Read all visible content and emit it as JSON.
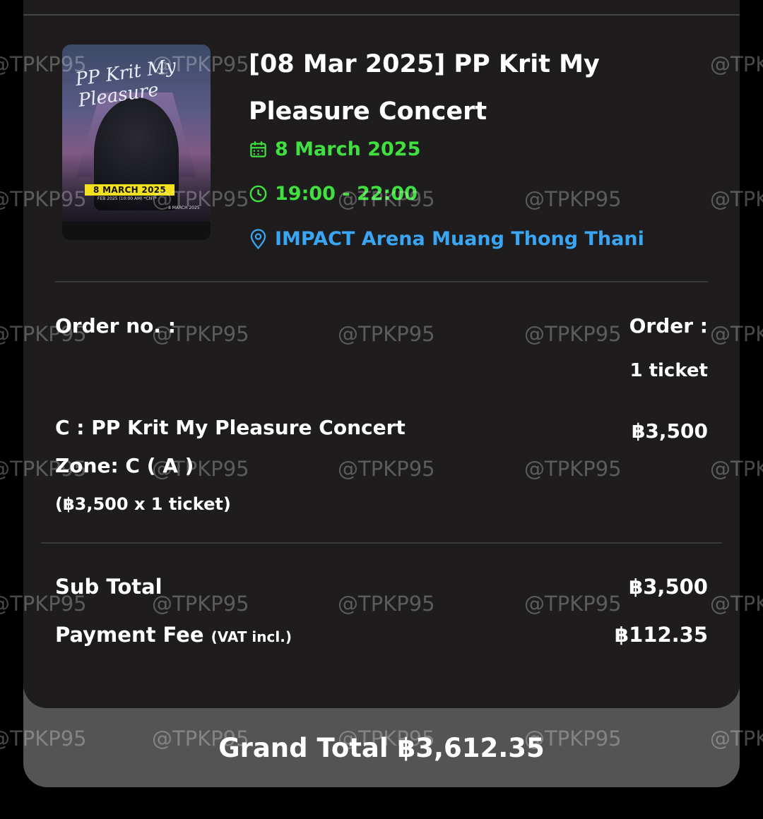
{
  "event": {
    "title": "[08 Mar 2025] PP Krit My Pleasure Concert",
    "date": "8 March 2025",
    "time": "19:00 - 22:00",
    "venue": "IMPACT Arena Muang Thong Thani",
    "poster": {
      "script_text": "PP Krit My Pleasure",
      "date_band": "8 MARCH 2025",
      "small_text": "FEB 2025 (10:00 AM) *CNT*",
      "small_text_2": "8 MARCH 2025"
    }
  },
  "order": {
    "order_no_label": "Order no. :",
    "order_label": "Order :",
    "order_count": "1 ticket",
    "item_name": "C : PP Krit My Pleasure Concert",
    "item_price": "฿3,500",
    "zone": "Zone: C ( A )",
    "item_breakdown": "(฿3,500 x 1 ticket)"
  },
  "summary": {
    "subtotal_label": "Sub Total",
    "subtotal_value": "฿3,500",
    "fee_label": "Payment Fee",
    "fee_note": "(VAT incl.)",
    "fee_value": "฿112.35",
    "grand_total": "Grand Total ฿3,612.35"
  },
  "watermark": "@TPKP95",
  "colors": {
    "green": "#3fe03f",
    "blue": "#3aa5f2",
    "card": "#1e1c1d",
    "footer": "#545454"
  }
}
